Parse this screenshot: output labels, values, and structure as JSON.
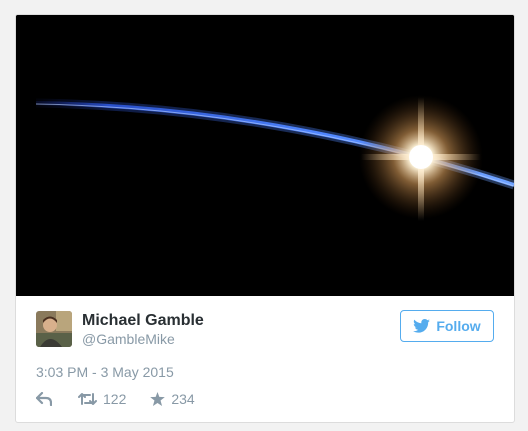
{
  "tweet": {
    "author_name": "Michael Gamble",
    "author_handle": "@GambleMike",
    "follow_label": "Follow",
    "timestamp": "3:03 PM - 3 May 2015",
    "retweet_count": "122",
    "favorite_count": "234"
  },
  "media": {
    "scene": "Sunrise over Earth's horizon seen from orbit"
  },
  "icons": {
    "follow": "twitter-bird-icon",
    "reply": "reply-icon",
    "retweet": "retweet-icon",
    "favorite": "star-icon"
  },
  "colors": {
    "accent": "#55acee",
    "name": "#292f33",
    "muted": "#8899a6"
  }
}
